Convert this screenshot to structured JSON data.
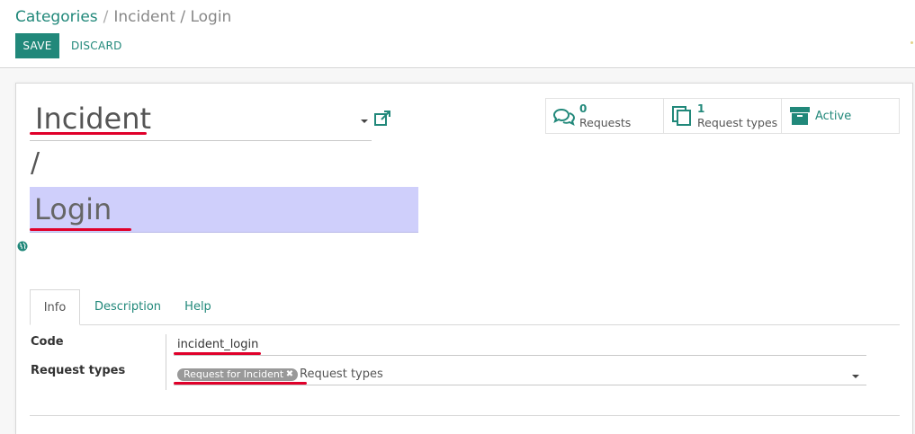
{
  "breadcrumb": {
    "root": "Categories",
    "separator": "/",
    "current": "Incident / Login"
  },
  "toolbar": {
    "save_label": "SAVE",
    "discard_label": "DISCARD"
  },
  "record": {
    "parent_name": "Incident",
    "slash": "/",
    "name": "Login"
  },
  "stat_buttons": [
    {
      "count": "0",
      "label": "Requests",
      "icon": "comments-icon"
    },
    {
      "count": "1",
      "label": "Request types",
      "icon": "copy-icon"
    },
    {
      "label": "Active",
      "icon": "archive-icon"
    }
  ],
  "tabs": [
    {
      "label": "Info",
      "active": true
    },
    {
      "label": "Description"
    },
    {
      "label": "Help"
    }
  ],
  "form": {
    "code_label": "Code",
    "code_value": "incident_login",
    "request_types_label": "Request types",
    "request_types_tag": "Request for Incident",
    "request_types_placeholder": "Request types"
  },
  "colors": {
    "accent": "#21887a",
    "highlight": "#cfcffb",
    "annotation_red": "#e0002a",
    "tag_bg": "#999999"
  }
}
